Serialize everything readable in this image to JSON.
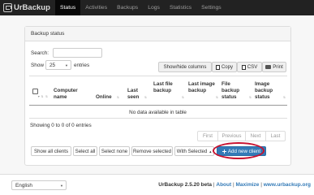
{
  "navbar": {
    "brand": "UrBackup",
    "items": [
      {
        "label": "Status",
        "active": true
      },
      {
        "label": "Activities",
        "active": false
      },
      {
        "label": "Backups",
        "active": false
      },
      {
        "label": "Logs",
        "active": false
      },
      {
        "label": "Statistics",
        "active": false
      },
      {
        "label": "Settings",
        "active": false
      }
    ]
  },
  "panel": {
    "title": "Backup status"
  },
  "search": {
    "label": "Search:",
    "value": ""
  },
  "show_entries": {
    "prefix": "Show",
    "value": "25",
    "suffix": "entries"
  },
  "toolbar": {
    "show_hide_columns": "Show/hide columns",
    "copy": "Copy",
    "csv": "CSV",
    "print": "Print"
  },
  "table": {
    "columns": [
      "Computer name",
      "Online",
      "Last seen",
      "Last file backup",
      "Last image backup",
      "File backup status",
      "Image backup status"
    ],
    "empty_message": "No data available in table"
  },
  "info": "Showing 0 to 0 of 0 entries",
  "pagination": [
    "First",
    "Previous",
    "Next",
    "Last"
  ],
  "actions": {
    "show_all_clients": "Show all clients",
    "select_all": "Select all",
    "select_none": "Select none",
    "remove_selected": "Remove selected",
    "with_selected": "With Selected",
    "add_new_client": "Add new client"
  },
  "footer": {
    "language": "English",
    "version": "UrBackup 2.5.20 beta",
    "about": "About",
    "maximize": "Maximize",
    "website": "www.urbackup.org",
    "separator": "|"
  },
  "colors": {
    "navbar": "#222222",
    "primary": "#337ab7",
    "highlight": "#c8102e"
  }
}
